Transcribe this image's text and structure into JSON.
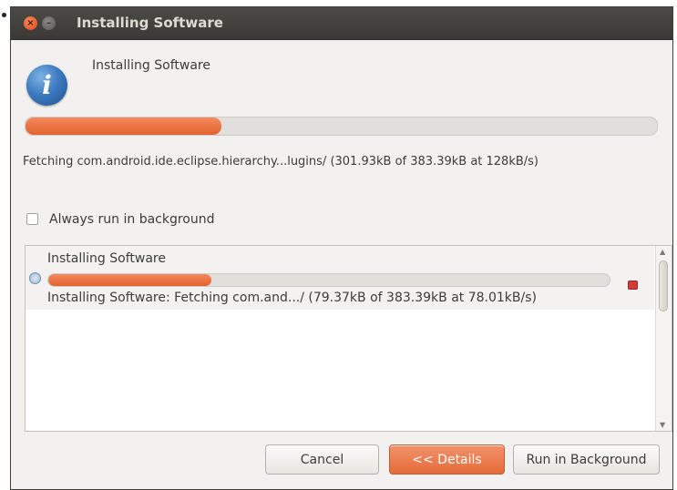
{
  "window": {
    "title": "Installing Software",
    "controls": {
      "close_icon": "close-icon",
      "minimize_icon": "minimize-icon"
    }
  },
  "dialog": {
    "heading": "Installing Software",
    "icon": "info-icon",
    "progress_fraction": 0.31,
    "status": "Fetching com.android.ide.eclipse.hierarchy...lugins/ (301.93kB of 383.39kB at 128kB/s)"
  },
  "checkbox": {
    "label": "Always run in background",
    "checked": false
  },
  "details": {
    "jobs": [
      {
        "title": "Installing Software",
        "progress_fraction": 0.29,
        "status": "Installing Software: Fetching com.and.../ (79.37kB of 383.39kB at 78.01kB/s)"
      }
    ]
  },
  "buttons": {
    "cancel": "Cancel",
    "details": "<< Details",
    "run_in_background": "Run in Background"
  },
  "colors": {
    "accent": "#e3622d",
    "titlebar": "#3c3b37",
    "background": "#f2f1f0"
  }
}
